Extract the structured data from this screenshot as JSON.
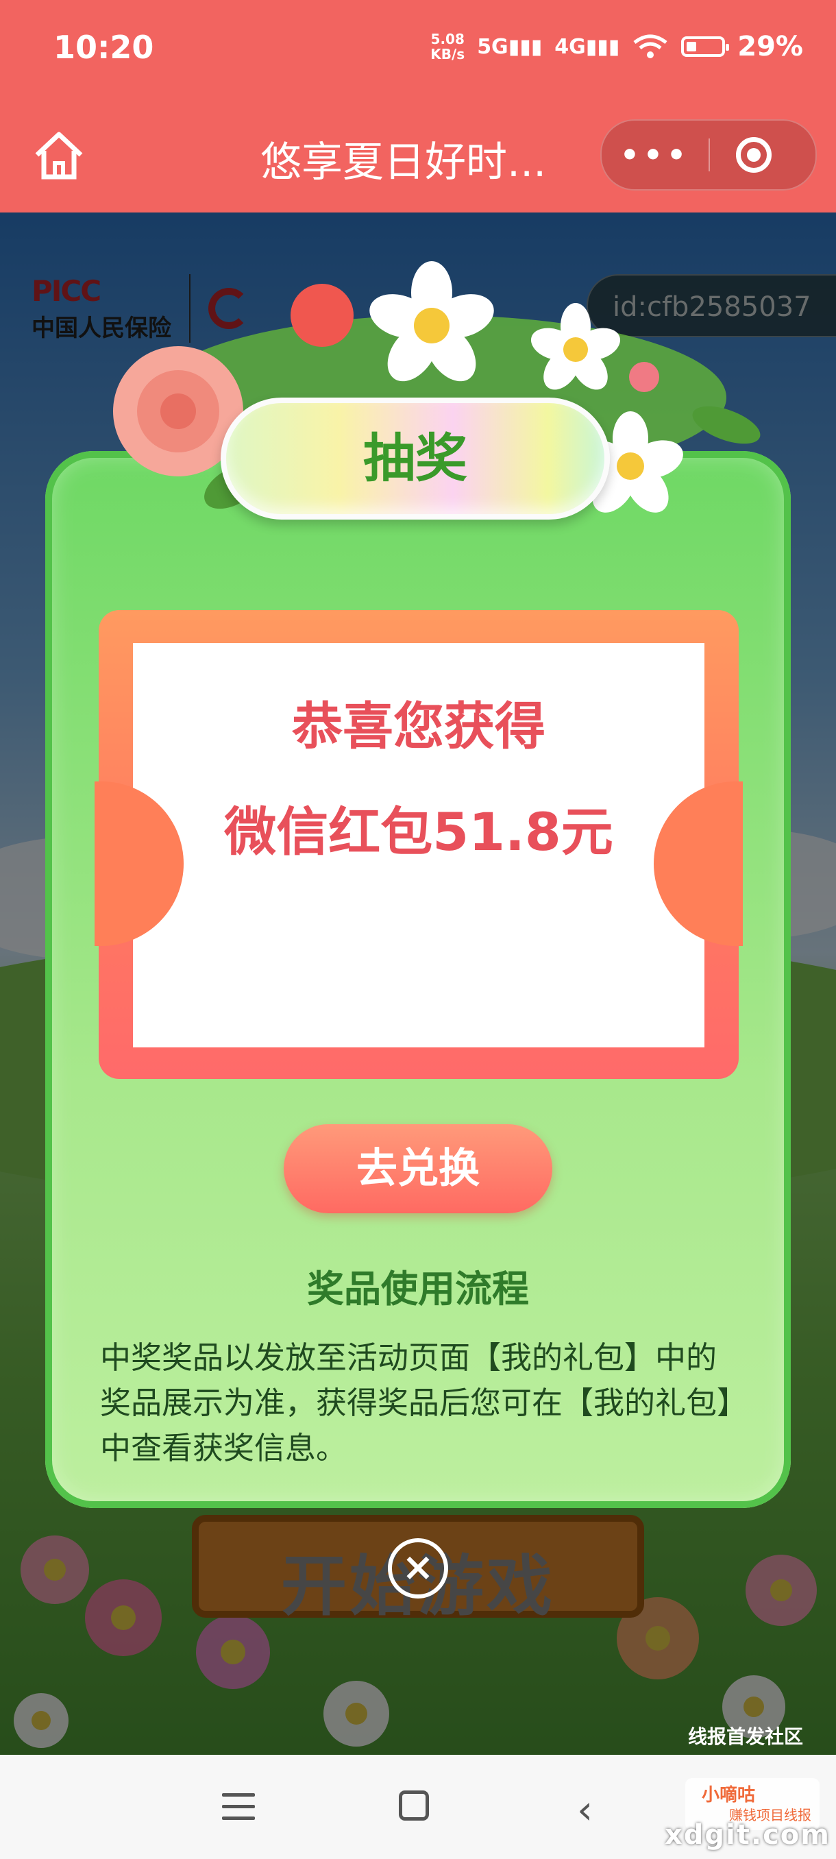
{
  "status_bar": {
    "time": "10:20",
    "net_speed_top": "5.08",
    "net_speed_unit": "KB/s",
    "sig1": "5G",
    "sig2": "4G",
    "battery": "29%"
  },
  "title_bar": {
    "title": "悠享夏日好时...",
    "more_label": "•••"
  },
  "brand": {
    "logo_text": "PICC",
    "company_name": "中国人民保险"
  },
  "user_id": "id:cfb2585037",
  "modal": {
    "heading": "抽奖",
    "ticket_title": "恭喜您获得",
    "prize": "微信红包51.8元",
    "redeem_button": "去兑换",
    "flow_title": "奖品使用流程",
    "flow_desc": "中奖奖品以发放至活动页面【我的礼包】中的奖品展示为准，获得奖品后您可在【我的礼包】中查看获奖信息。"
  },
  "background": {
    "start_button": "开始游戏"
  },
  "close_symbol": "×",
  "watermark": {
    "text": "线报首发社区",
    "name": "小嘀咕",
    "sub": "赚钱项目线报",
    "domain": "xdgit.com"
  },
  "colors": {
    "header": "#f26460",
    "modal_green": "#6ed864",
    "accent_red": "#e8505a"
  }
}
